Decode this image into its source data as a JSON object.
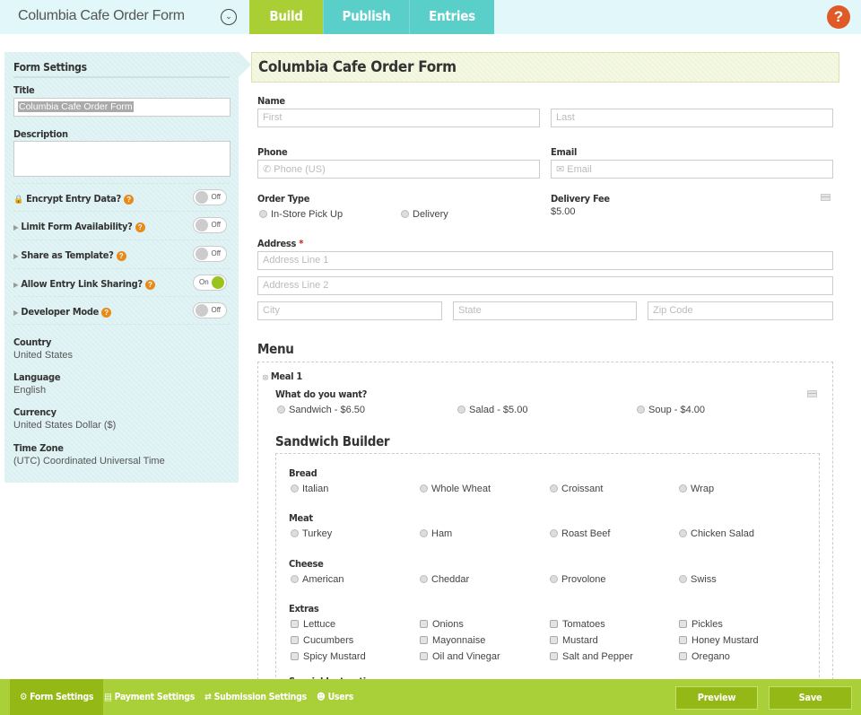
{
  "header": {
    "app_title": "Columbia Cafe Order Form",
    "tabs": [
      {
        "label": "Build",
        "active": true
      },
      {
        "label": "Publish",
        "active": false
      },
      {
        "label": "Entries",
        "active": false
      }
    ],
    "help_label": "?"
  },
  "sidebar": {
    "heading": "Form Settings",
    "title_label": "Title",
    "title_value": "Columbia Cafe Order Form",
    "description_label": "Description",
    "description_value": "",
    "toggles": [
      {
        "label": "Encrypt Entry Data?",
        "state": "Off",
        "icon": "lock-icon"
      },
      {
        "label": "Limit Form Availability?",
        "state": "Off",
        "icon": "caret-right-icon"
      },
      {
        "label": "Share as Template?",
        "state": "Off",
        "icon": "caret-right-icon"
      },
      {
        "label": "Allow Entry Link Sharing?",
        "state": "On",
        "icon": "caret-right-icon"
      },
      {
        "label": "Developer Mode",
        "state": "Off",
        "icon": "caret-right-icon"
      }
    ],
    "info": [
      {
        "key": "Country",
        "value": "United States"
      },
      {
        "key": "Language",
        "value": "English"
      },
      {
        "key": "Currency",
        "value": "United States Dollar ($)"
      },
      {
        "key": "Time Zone",
        "value": "(UTC) Coordinated Universal Time"
      }
    ]
  },
  "form": {
    "title": "Columbia Cafe Order Form",
    "name_label": "Name",
    "first_placeholder": "First",
    "last_placeholder": "Last",
    "phone_label": "Phone",
    "phone_placeholder": "Phone (US)",
    "email_label": "Email",
    "email_placeholder": "Email",
    "order_type_label": "Order Type",
    "order_types": [
      "In-Store Pick Up",
      "Delivery"
    ],
    "delivery_fee_label": "Delivery Fee",
    "delivery_fee_value": "$5.00",
    "address_label": "Address",
    "required_mark": "*",
    "address1_placeholder": "Address Line 1",
    "address2_placeholder": "Address Line 2",
    "city_placeholder": "City",
    "state_placeholder": "State",
    "zip_placeholder": "Zip Code",
    "menu_title": "Menu",
    "meal_label": "Meal 1",
    "want_label": "What do you want?",
    "want_options": [
      "Sandwich - $6.50",
      "Salad - $5.00",
      "Soup - $4.00"
    ],
    "builder_title": "Sandwich Builder",
    "bread_label": "Bread",
    "bread_options": [
      "Italian",
      "Whole Wheat",
      "Croissant",
      "Wrap"
    ],
    "meat_label": "Meat",
    "meat_options": [
      "Turkey",
      "Ham",
      "Roast Beef",
      "Chicken Salad"
    ],
    "cheese_label": "Cheese",
    "cheese_options": [
      "American",
      "Cheddar",
      "Provolone",
      "Swiss"
    ],
    "extras_label": "Extras",
    "extras_options": [
      "Lettuce",
      "Onions",
      "Tomatoes",
      "Pickles",
      "Cucumbers",
      "Mayonnaise",
      "Mustard",
      "Honey Mustard",
      "Spicy Mustard",
      "Oil and Vinegar",
      "Salt and Pepper",
      "Oregano"
    ],
    "special_label": "Special Instructions"
  },
  "footer": {
    "tabs": [
      {
        "label": "Form Settings",
        "icon": "gear-icon",
        "active": true
      },
      {
        "label": "Payment Settings",
        "icon": "credit-card-icon",
        "active": false
      },
      {
        "label": "Submission Settings",
        "icon": "shuffle-icon",
        "active": false
      },
      {
        "label": "Users",
        "icon": "users-icon",
        "active": false
      }
    ],
    "preview_label": "Preview",
    "save_label": "Save"
  },
  "colors": {
    "accent_green": "#aad039",
    "accent_teal": "#5acec8",
    "help_orange": "#e05a28"
  }
}
